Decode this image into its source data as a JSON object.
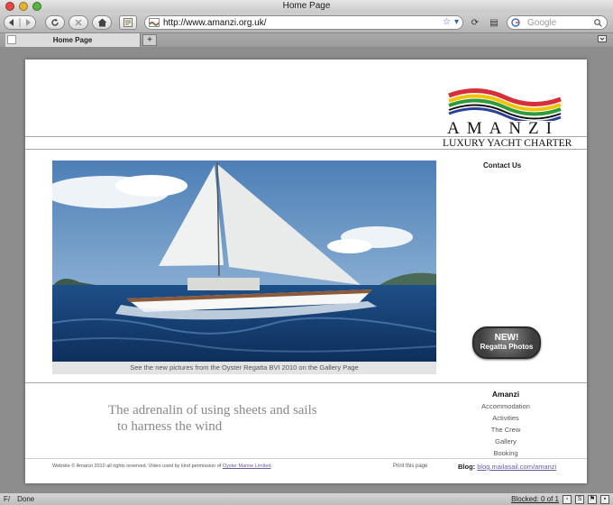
{
  "window": {
    "title": "Home Page"
  },
  "toolbar": {
    "url": "http://www.amanzi.org.uk/",
    "search_placeholder": "Google"
  },
  "tabs": [
    {
      "label": "Home Page"
    }
  ],
  "tab_new_label": "+",
  "status": {
    "text": "Done",
    "blocked": "Blocked: 0 of 1",
    "f_label": "F/"
  },
  "brand": {
    "name": "AMANZI",
    "tagline": "LUXURY YACHT CHARTER"
  },
  "header_links": {
    "contact": "Contact Us"
  },
  "hero": {
    "caption": "See the new pictures from the Oyster Regatta BVI 2010 on the Gallery Page"
  },
  "badge": {
    "line1": "NEW!",
    "line2": "Regatta Photos"
  },
  "slogan": {
    "line1": "The adrenalin of using sheets and sails",
    "line2": "to harness the wind"
  },
  "nav": {
    "heading": "Amanzi",
    "items": [
      "Accommodation",
      "Activities",
      "The Crew",
      "Gallery",
      "Booking"
    ]
  },
  "footer": {
    "copyright": "Website © Amanzi 2010 all rights reserved. Video used by kind permission of",
    "credit_link": "Oyster Marine Limited",
    "print": "Print this page",
    "blog_label": "Blog:",
    "blog_link": "blog.mailasail.com/amanzi"
  },
  "colors": {
    "page_bg": "#ffffff",
    "chrome": "#c4c4c4",
    "link": "#6b5aa0",
    "logo_red": "#d62f3a",
    "logo_yellow": "#f2c300",
    "logo_green": "#2f9a3c",
    "logo_blue": "#2a3f95"
  }
}
